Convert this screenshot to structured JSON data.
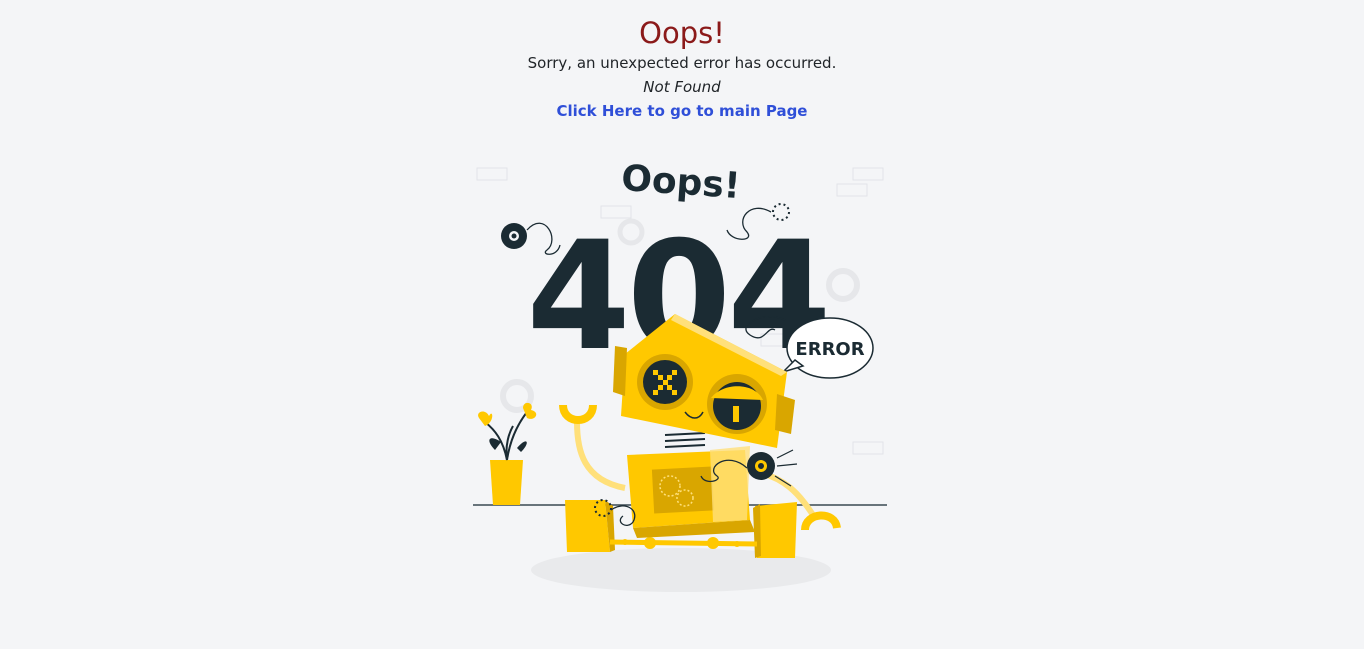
{
  "error": {
    "title": "Oops!",
    "message": "Sorry, an unexpected error has occurred.",
    "status_text": "Not Found",
    "home_link_label": "Click Here to go to main Page"
  },
  "illustration": {
    "heading_text": "Oops!",
    "code_text": "404",
    "bubble_text": "ERROR"
  },
  "colors": {
    "title": "#8b1a1a",
    "link": "#2f4fd8",
    "robot_yellow": "#ffc800",
    "robot_dark_yellow": "#d9a600",
    "ink": "#1b2b33"
  }
}
